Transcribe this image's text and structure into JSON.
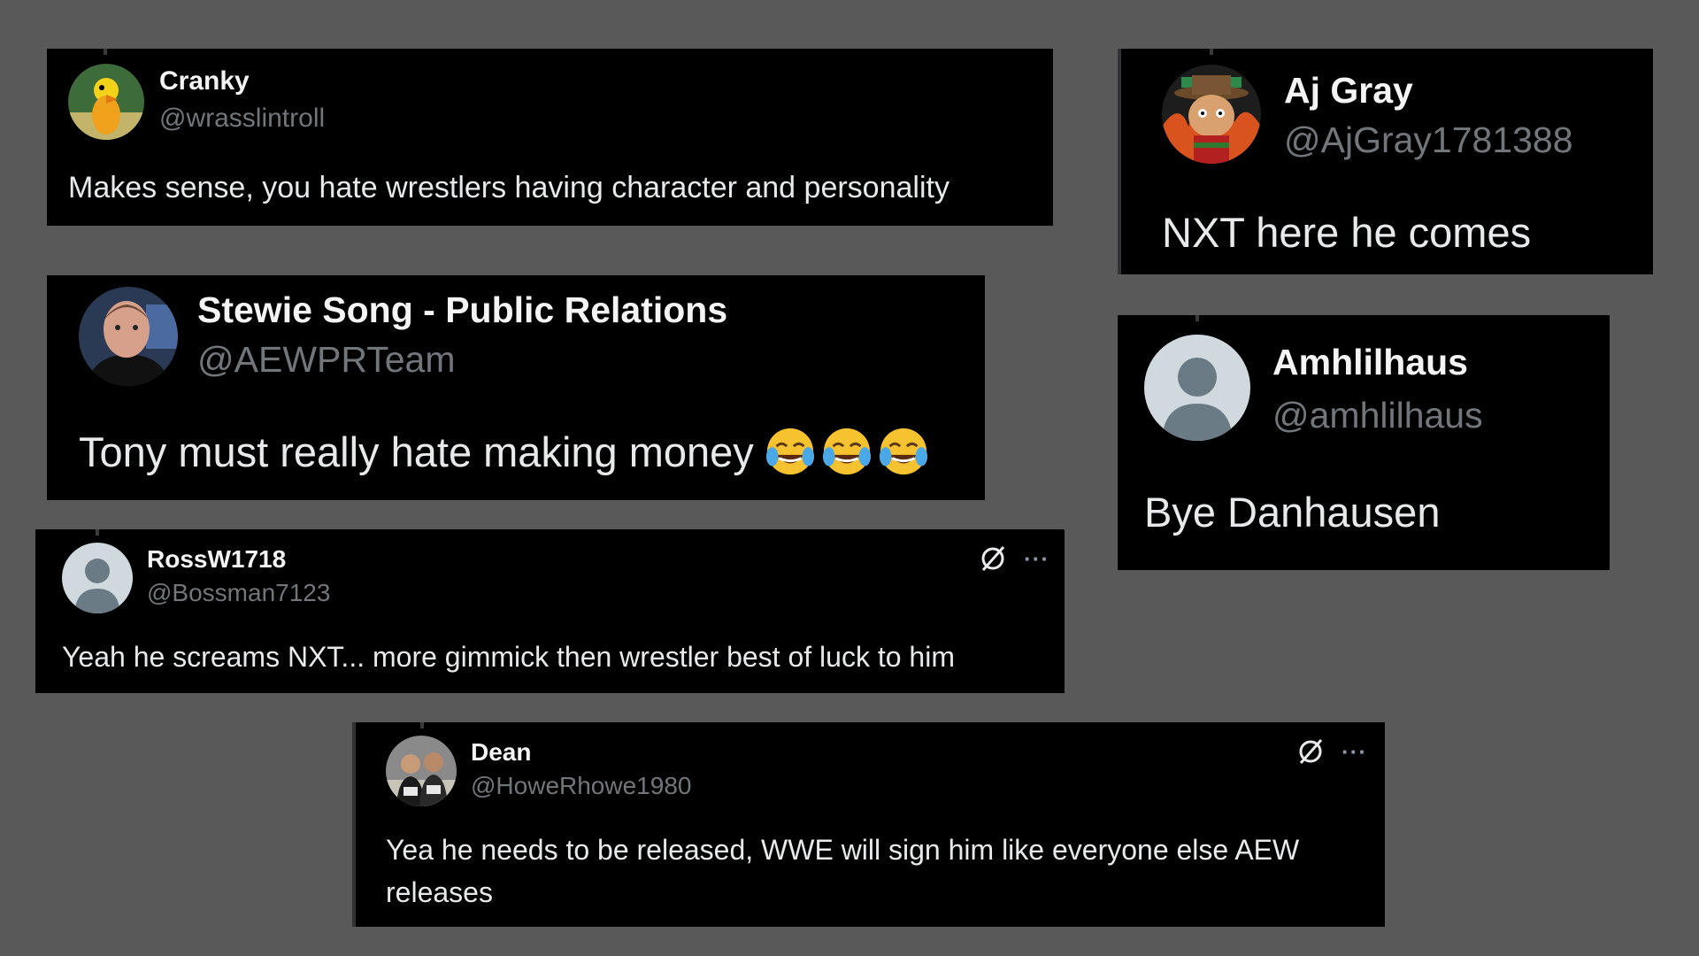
{
  "posts": [
    {
      "name": "Cranky",
      "handle": "@wrasslintroll",
      "text": "Makes sense, you hate wrestlers having character and personality",
      "avatar_icon": "cartoon-duck-avatar"
    },
    {
      "name": "Aj Gray",
      "handle": "@AjGray1781388",
      "text": "NXT here he comes",
      "avatar_icon": "cartoon-freddy-avatar"
    },
    {
      "name": "Stewie Song - Public Relations",
      "handle": "@AEWPRTeam",
      "text": "Tony must really hate making money",
      "emoji": "face-with-tears-of-joy x3",
      "avatar_icon": "man-photo-avatar"
    },
    {
      "name": "Amhlilhaus",
      "handle": "@amhlilhaus",
      "text": "Bye Danhausen",
      "avatar_icon": "default-profile-avatar"
    },
    {
      "name": "RossW1718",
      "handle": "@Bossman7123",
      "text": "Yeah he screams NXT... more gimmick then wrestler best of luck to him",
      "avatar_icon": "default-profile-avatar",
      "more_label": "···"
    },
    {
      "name": "Dean",
      "handle": "@HoweRhowe1980",
      "text": "Yea he needs to be released, WWE will sign him like everyone else AEW releases",
      "avatar_icon": "group-photo-avatar",
      "more_label": "···"
    }
  ],
  "colors": {
    "background": "#595959",
    "card": "#000000",
    "name": "#f4f4f4",
    "handle": "#71767b",
    "text": "#e7e9ea"
  }
}
